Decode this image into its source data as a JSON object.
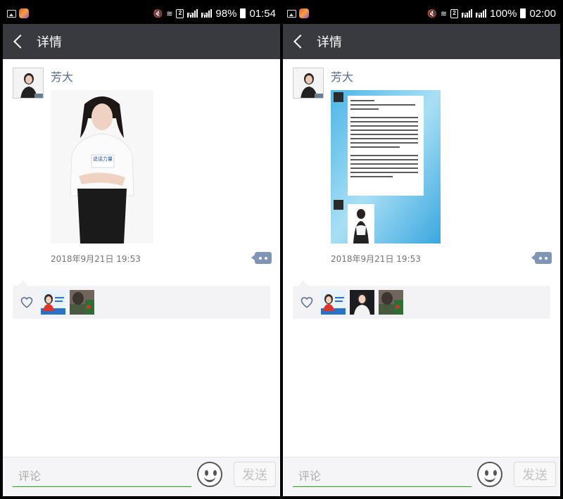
{
  "colors": {
    "header_bg": "#393a3f",
    "author_name": "#576b95",
    "comment_button": "#7e95b5",
    "input_underline": "#1aad19",
    "likes_bg": "#f3f3f5"
  },
  "screens": [
    {
      "status": {
        "battery_pct": "98%",
        "time": "01:54",
        "battery_level": 0.98
      },
      "header": {
        "title": "详情"
      },
      "post": {
        "author": "芳大",
        "photo_text": "说话力量",
        "timestamp": "2018年9月21日 19:53",
        "liker_icons": [
          "liker-avatar-profile-card",
          "liker-avatar-outdoor"
        ]
      },
      "bottom": {
        "placeholder": "评论",
        "send": "发送"
      }
    },
    {
      "status": {
        "battery_pct": "100%",
        "time": "02:00",
        "battery_level": 1.0
      },
      "header": {
        "title": "详情"
      },
      "post": {
        "author": "芳大",
        "timestamp": "2018年9月21日 19:53",
        "liker_icons": [
          "liker-avatar-profile-card",
          "liker-avatar-woman",
          "liker-avatar-outdoor"
        ]
      },
      "bottom": {
        "placeholder": "评论",
        "send": "发送"
      }
    }
  ]
}
